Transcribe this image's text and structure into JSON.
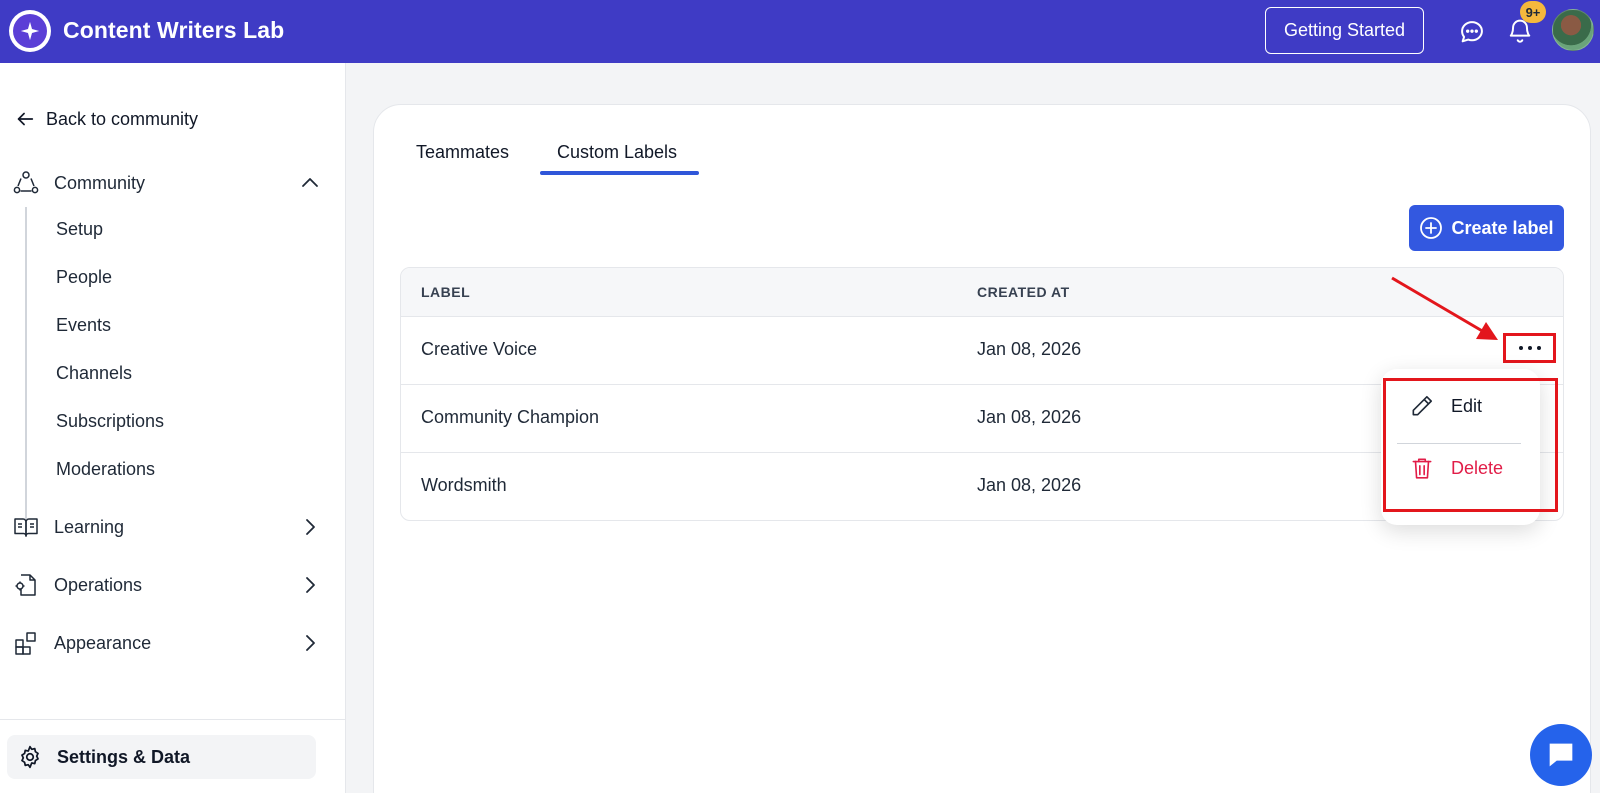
{
  "header": {
    "app_title": "Content Writers Lab",
    "getting_started_label": "Getting Started",
    "notification_badge": "9+",
    "brand_color": "#3f3bc5"
  },
  "sidebar": {
    "back_label": "Back to community",
    "community": {
      "label": "Community",
      "expanded": true,
      "items": [
        "Setup",
        "People",
        "Events",
        "Channels",
        "Subscriptions",
        "Moderations"
      ]
    },
    "sections": [
      {
        "label": "Learning",
        "icon": "book-icon"
      },
      {
        "label": "Operations",
        "icon": "gear-file-icon"
      },
      {
        "label": "Appearance",
        "icon": "layout-icon"
      }
    ],
    "settings_label": "Settings & Data"
  },
  "main": {
    "tabs": [
      {
        "label": "Teammates",
        "active": false
      },
      {
        "label": "Custom Labels",
        "active": true
      }
    ],
    "create_button_label": "Create label",
    "table": {
      "columns": [
        "LABEL",
        "CREATED AT"
      ],
      "rows": [
        {
          "label": "Creative Voice",
          "created_at": "Jan 08, 2026"
        },
        {
          "label": "Community Champion",
          "created_at": "Jan 08, 2026"
        },
        {
          "label": "Wordsmith",
          "created_at": "Jan 08, 2026"
        }
      ]
    },
    "row_menu": {
      "edit_label": "Edit",
      "delete_label": "Delete",
      "delete_color": "#e11d48"
    }
  },
  "annotation_color": "#e3161c"
}
